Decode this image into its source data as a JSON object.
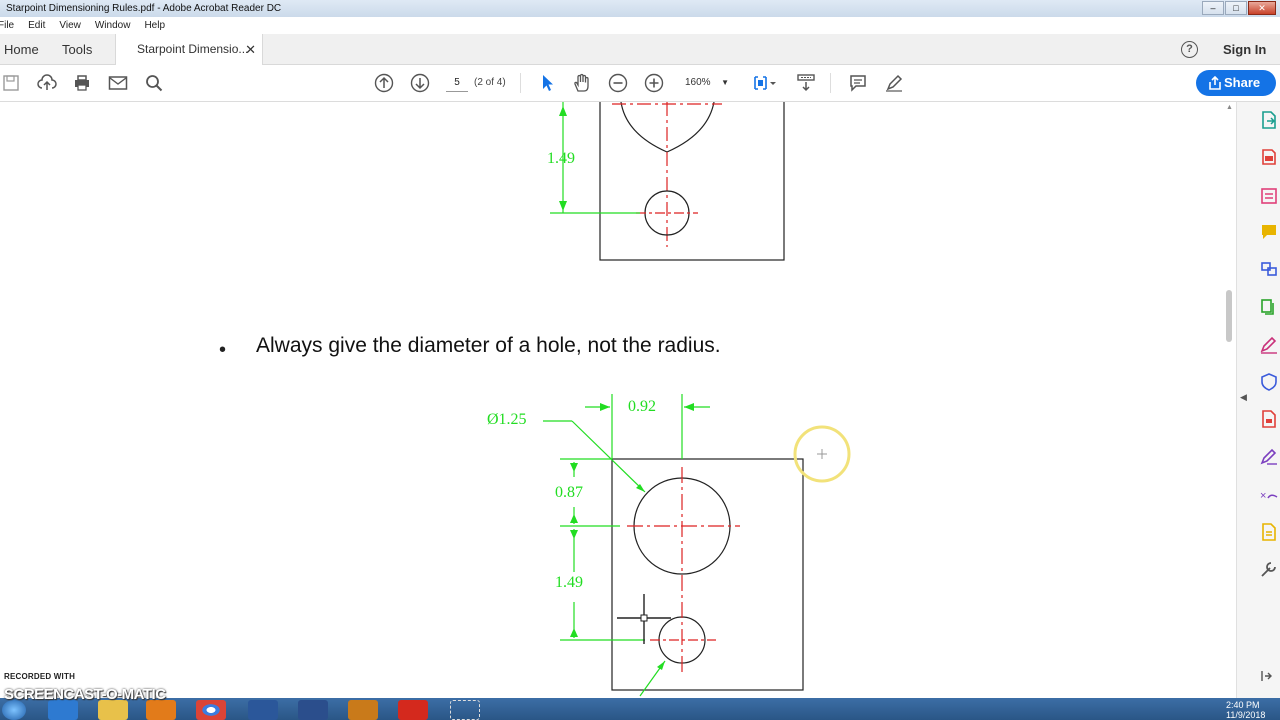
{
  "window": {
    "title": "Starpoint Dimensioning Rules.pdf - Adobe Acrobat Reader DC"
  },
  "menu": [
    "File",
    "Edit",
    "View",
    "Window",
    "Help"
  ],
  "tabs": {
    "home": "Home",
    "tools": "Tools",
    "document": "Starpoint Dimensio..."
  },
  "header": {
    "sign_in": "Sign In",
    "help_symbol": "?"
  },
  "toolbar": {
    "page_number": "5",
    "page_of": "(2 of 4)",
    "zoom": "160%",
    "share_label": "Share"
  },
  "document": {
    "bullet_text": "Always give the diameter of a hole, not the radius.",
    "upper_drawing": {
      "vertical_dim": "1.49"
    },
    "lower_drawing": {
      "diameter_dim": "Ø1.25",
      "horizontal_dim": "0.92",
      "top_dim": "0.87",
      "vertical_dim": "1.49"
    }
  },
  "colors": {
    "dimension": "#22dd22",
    "centerline": "#dd2222",
    "share_button": "#1473e6"
  },
  "watermark": {
    "line1": "RECORDED WITH",
    "line2": "SCREENCAST-O-MATIC"
  },
  "taskbar": {
    "time": "2:40 PM",
    "date": "11/9/2018"
  }
}
